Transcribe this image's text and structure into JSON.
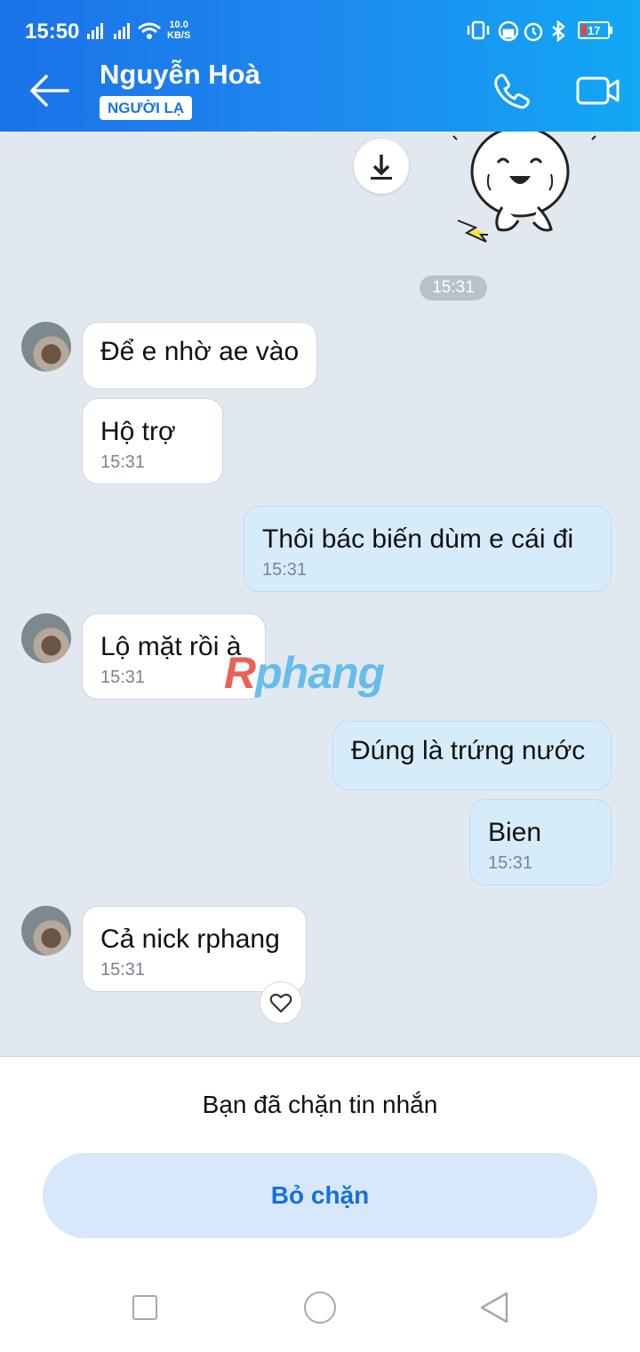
{
  "status_bar": {
    "time": "15:50",
    "net_speed_value": "10.0",
    "net_speed_unit": "KB/S",
    "battery": "17",
    "battery_color": "#ff3b3b"
  },
  "header": {
    "contact_name": "Nguyễn Hoà",
    "badge": "NGƯỜI LẠ",
    "back_icon": "arrow-left-icon",
    "call_icon": "phone-icon",
    "video_icon": "video-camera-icon",
    "gradient_start": "#1a73e8",
    "gradient_end": "#12a8f5"
  },
  "chat": {
    "timestamp_chip": "15:31",
    "watermark": "Rphang",
    "messages": [
      {
        "side": "in",
        "text": "Để e nhờ ae vào",
        "time": ""
      },
      {
        "side": "in",
        "text": "Hộ trợ",
        "time": "15:31"
      },
      {
        "side": "out",
        "text": "Thôi bác biến dùm e cái đi",
        "time": "15:31"
      },
      {
        "side": "in",
        "text": "Lộ mặt rồi à",
        "time": "15:31"
      },
      {
        "side": "out",
        "text": "Đúng là trứng nước",
        "time": ""
      },
      {
        "side": "out",
        "text": "Bien",
        "time": "15:31"
      },
      {
        "side": "in",
        "text": "Cả nick rphang",
        "time": "15:31"
      }
    ]
  },
  "footer": {
    "blocked_text": "Bạn đã chặn tin nhắn",
    "unblock_label": "Bỏ chặn"
  },
  "colors": {
    "chat_bg": "#e2e8f0",
    "outgoing_bubble": "#d6ecfb",
    "incoming_bubble": "#ffffff",
    "accent": "#1470e0"
  }
}
